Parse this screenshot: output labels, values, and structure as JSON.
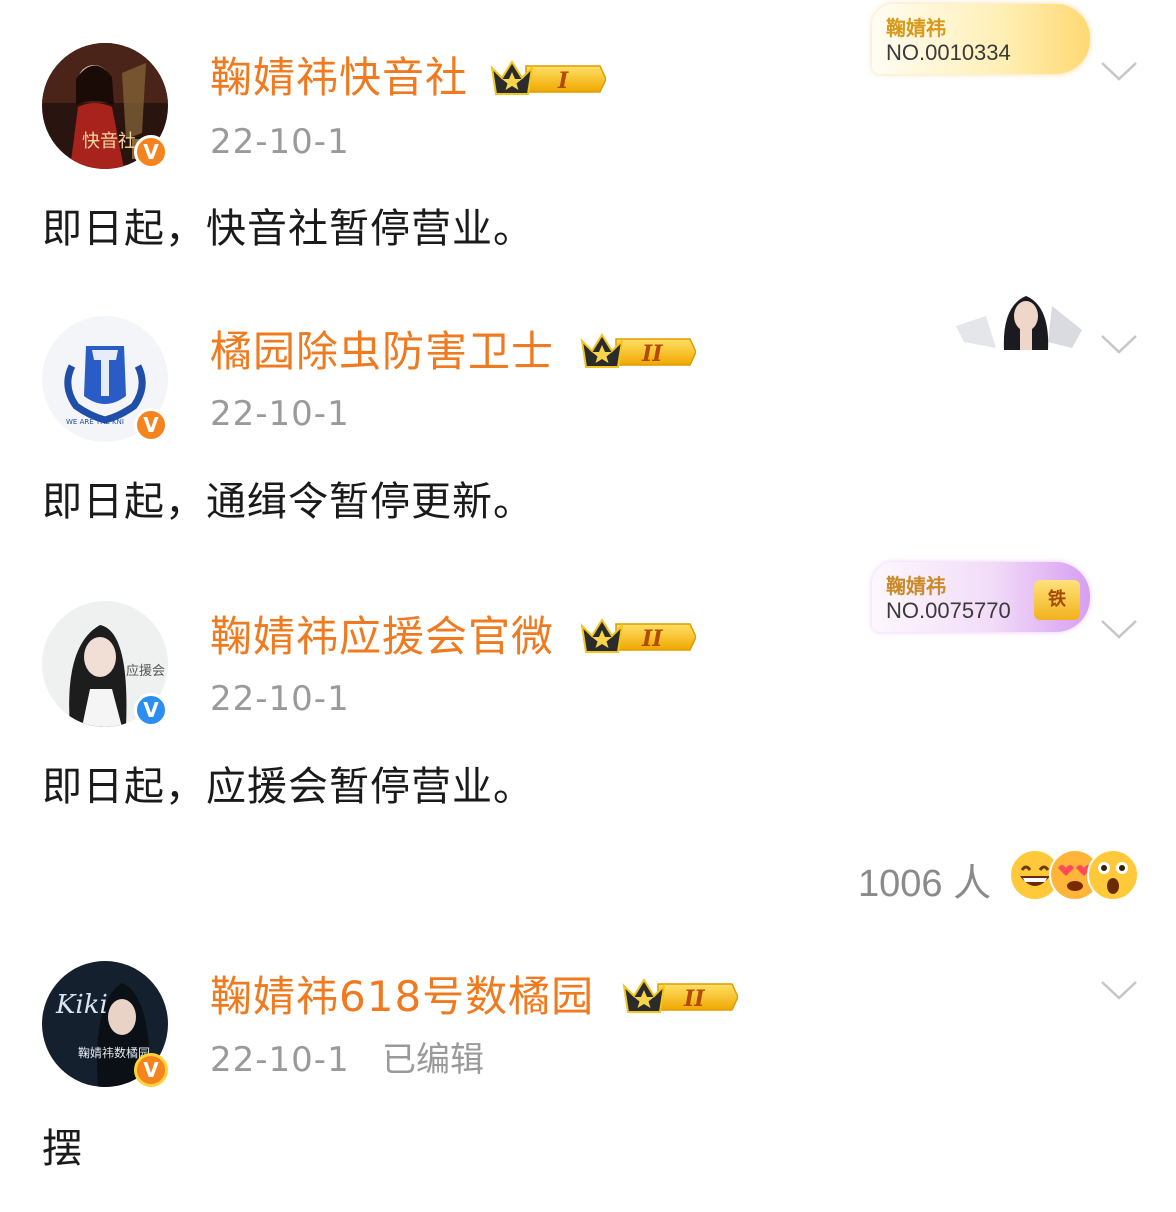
{
  "comments": [
    {
      "username": "鞠婧祎快音社",
      "level": "I",
      "date": "22-10-1",
      "content": "即日起，快音社暂停营业。",
      "verify_color": "#f5831e",
      "avatar_text": "快音社",
      "fan_card": {
        "name": "鞠婧祎",
        "number": "NO.0010334"
      }
    },
    {
      "username": "橘园除虫防害卫士",
      "level": "II",
      "date": "22-10-1",
      "content": "即日起，通缉令暂停更新。",
      "verify_color": "#f5831e",
      "avatar_text": "WE ARE THE KNI"
    },
    {
      "username": "鞠婧祎应援会官微",
      "level": "II",
      "date": "22-10-1",
      "content": "即日起，应援会暂停营业。",
      "verify_color": "#2c8ef0",
      "avatar_text": "应援会",
      "fan_card": {
        "name": "鞠婧祎",
        "number": "NO.0075770",
        "badge": "铁"
      }
    },
    {
      "username": "鞠婧祎618号数橘园",
      "level": "II",
      "date": "22-10-1",
      "edited": "已编辑",
      "content": "摆",
      "verify_color": "#f5831e",
      "avatar_text": "鞠婧祎数橘园",
      "avatar_logo": "Kiki"
    }
  ],
  "reactions": {
    "count": "1006 人",
    "emojis": [
      "grin-emoji",
      "heart-eyes-emoji",
      "surprised-emoji"
    ]
  },
  "colors": {
    "username": "#f07a1f",
    "date": "#9a9a9a",
    "text": "#1a1a1a"
  }
}
